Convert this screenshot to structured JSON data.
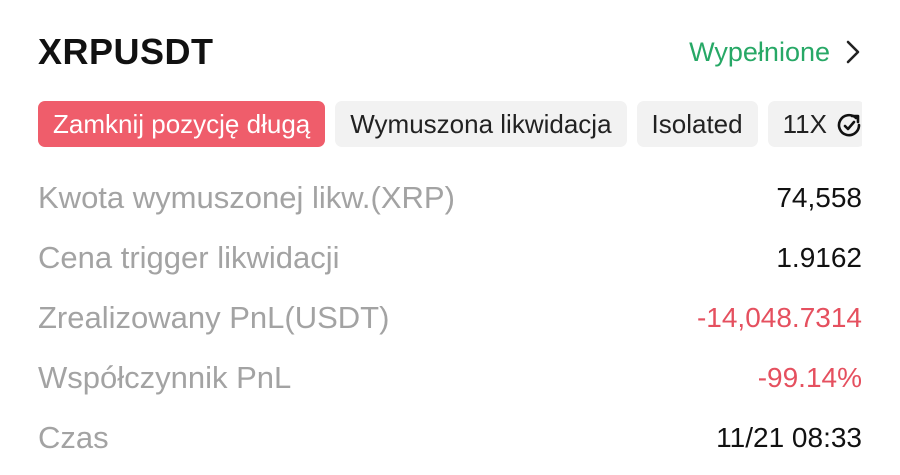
{
  "header": {
    "symbol": "XRPUSDT",
    "status": "Wypełnione"
  },
  "tags": [
    {
      "label": "Zamknij pozycję długą",
      "color": "#ef5d6b"
    },
    {
      "label": "Wymuszona likwidacja"
    },
    {
      "label": "Isolated"
    },
    {
      "label": "11X"
    }
  ],
  "details": [
    {
      "label": "Kwota wymuszonej likw.(XRP)",
      "value": "74,558"
    },
    {
      "label": "Cena trigger likwidacji",
      "value": "1.9162"
    },
    {
      "label": "Zrealizowany PnL(USDT)",
      "value": "-14,048.7314",
      "color": "#e5505f"
    },
    {
      "label": "Współczynnik PnL",
      "value": "-99.14%",
      "color": "#e5505f"
    },
    {
      "label": "Czas",
      "value": "11/21 08:33"
    }
  ],
  "colors": {
    "accent_green": "#27a866",
    "negative_red": "#e5505f",
    "label_gray": "#a3a3a3"
  },
  "icons": {
    "status_chevron": "chevron-right-icon",
    "leverage": "leverage-adjust-icon"
  }
}
